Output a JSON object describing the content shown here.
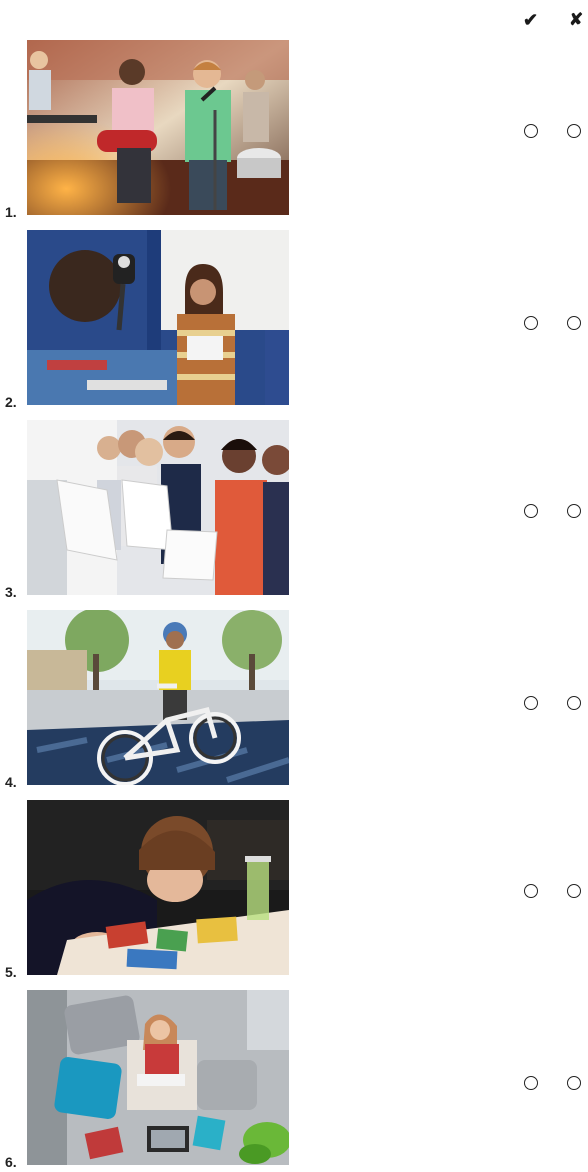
{
  "header": {
    "check_symbol": "✔",
    "cross_symbol": "✘",
    "check_icon": "check-icon",
    "cross_icon": "cross-icon"
  },
  "items": [
    {
      "number": "1.",
      "picture": "band-performing-photo"
    },
    {
      "number": "2.",
      "picture": "girl-filmed-reading-photo"
    },
    {
      "number": "3.",
      "picture": "choir-singing-photo"
    },
    {
      "number": "4.",
      "picture": "boy-riding-bike-photo"
    },
    {
      "number": "5.",
      "picture": "boy-making-collage-photo"
    },
    {
      "number": "6.",
      "picture": "girl-reading-on-floor-photo"
    }
  ],
  "colors": {
    "radio_border": "#222222",
    "text": "#1a1a1a"
  }
}
